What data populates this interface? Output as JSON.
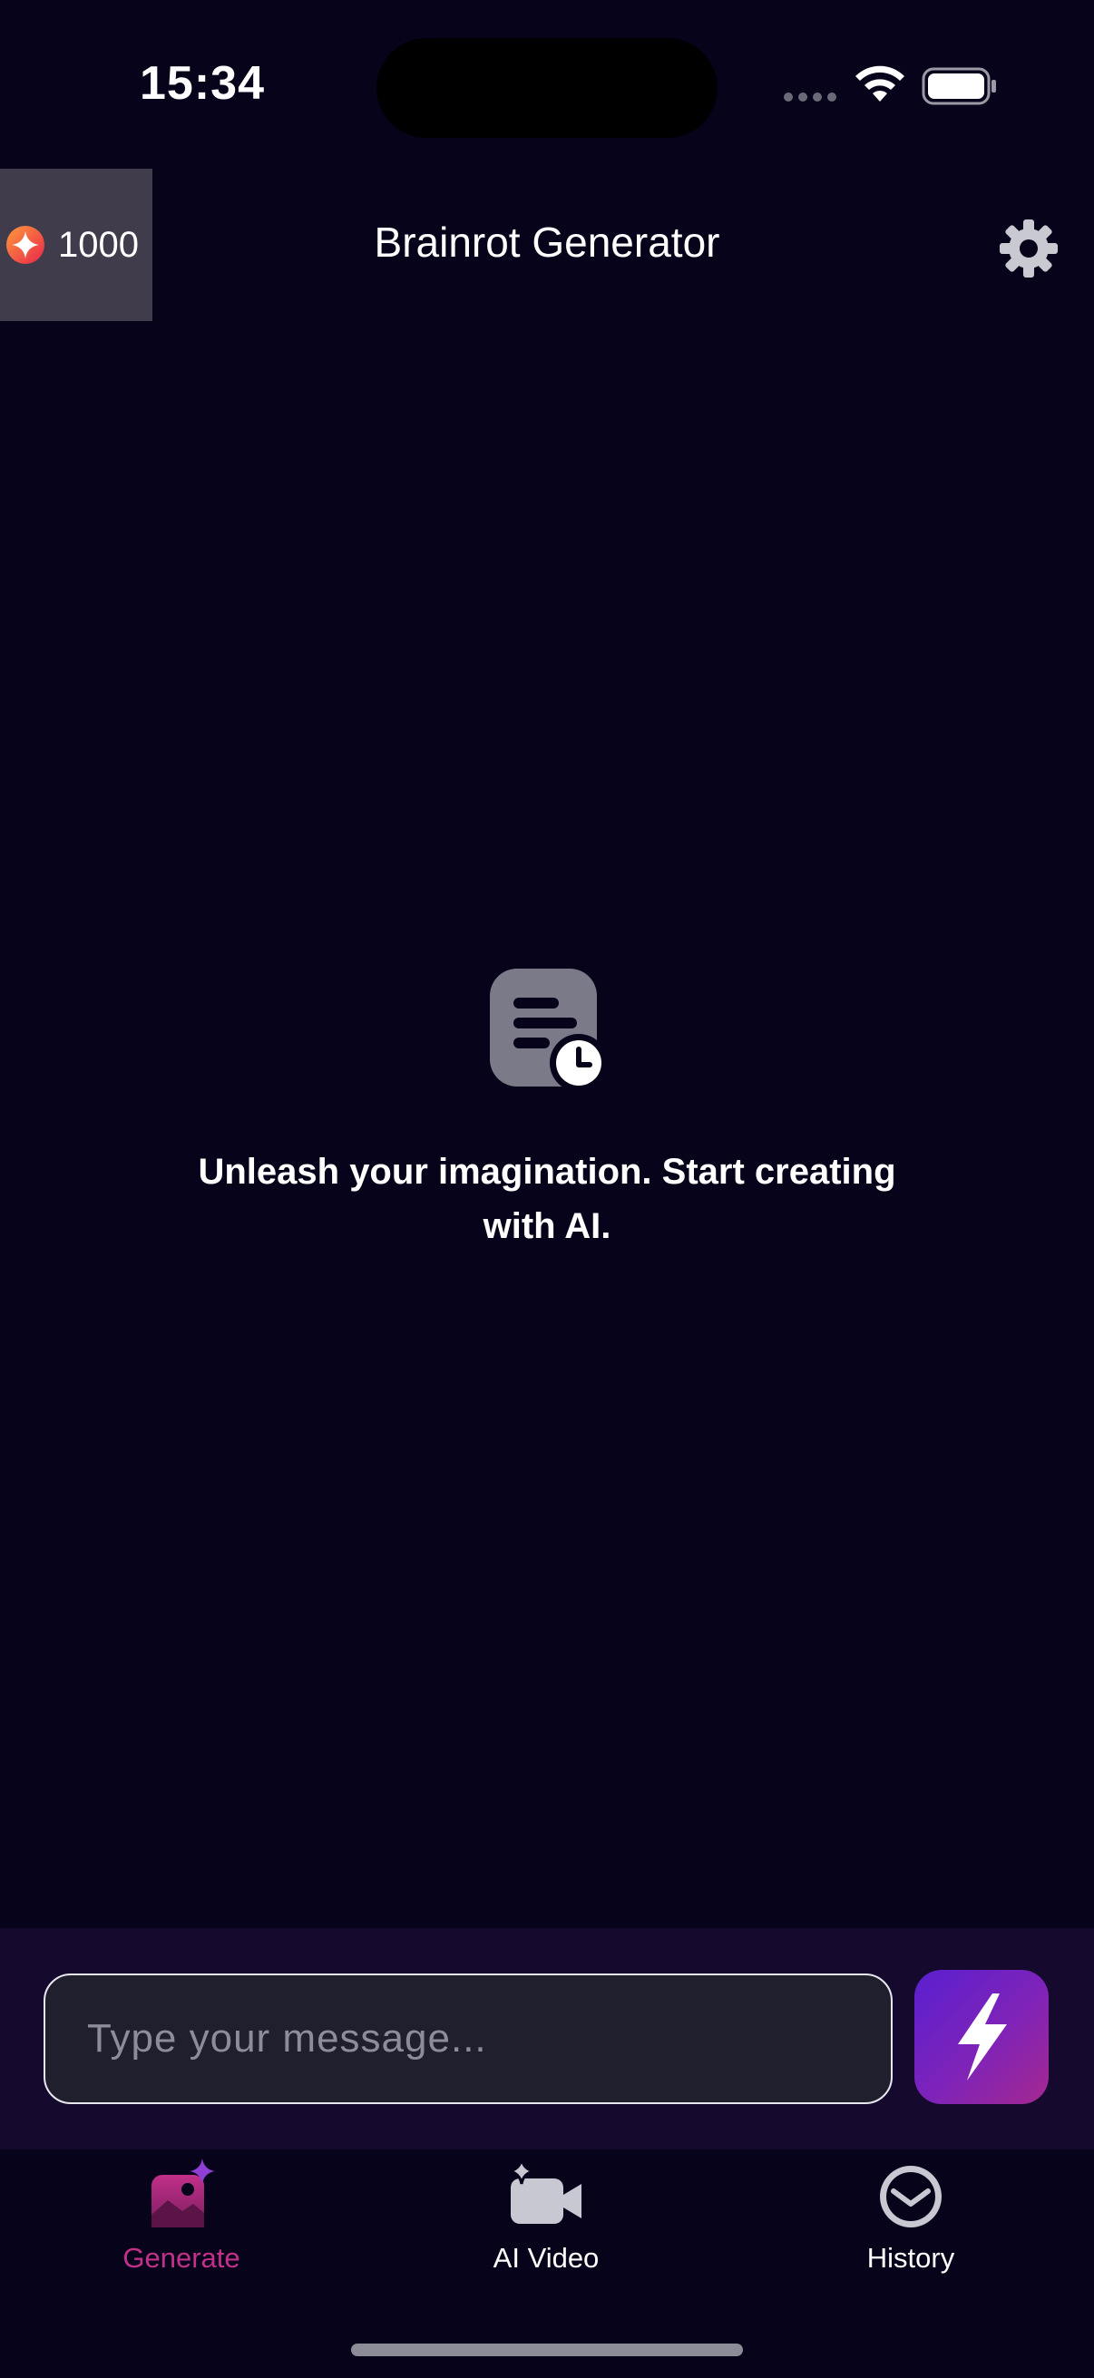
{
  "status_bar": {
    "time": "15:34"
  },
  "header": {
    "credits": "1000",
    "title": "Brainrot Generator"
  },
  "empty_state": {
    "message": "Unleash your imagination. Start creating with AI."
  },
  "composer": {
    "placeholder": "Type your message..."
  },
  "tabs": [
    {
      "label": "Generate",
      "icon": "generate-icon",
      "active": true
    },
    {
      "label": "AI Video",
      "icon": "video-icon",
      "active": false
    },
    {
      "label": "History",
      "icon": "history-icon",
      "active": false
    }
  ],
  "colors": {
    "background": "#07031a",
    "accent": "#c2308a",
    "send_gradient_start": "#5a1fd0",
    "send_gradient_end": "#a52890",
    "inactive_icon": "#c8c8d2"
  }
}
